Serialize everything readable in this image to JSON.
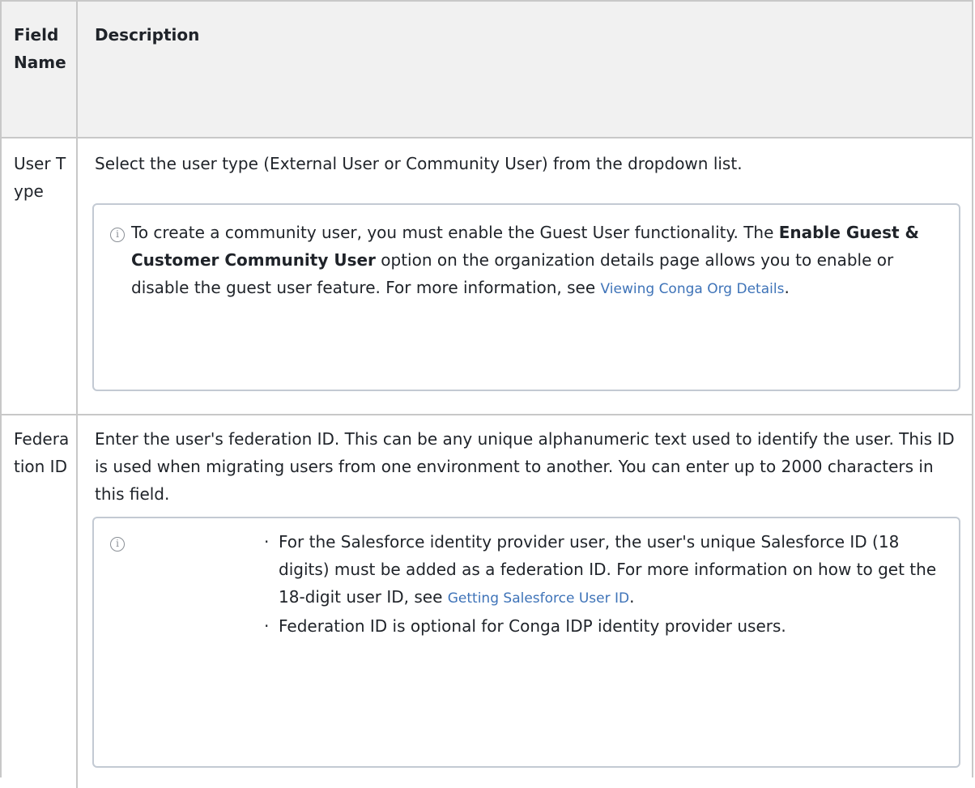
{
  "header": {
    "field_name": "Field Name",
    "description": "Description"
  },
  "rows": [
    {
      "field": "User Type",
      "description": "Select the user type (External User or Community User) from the dropdown list.",
      "note": {
        "icon": "info-icon",
        "text_before": "To create a community user, you must enable the Guest User functionality. The ",
        "bold": "Enable Guest & Customer Community User",
        "text_after": " option on the organization details page allows you to enable or disable the guest user feature. For more information, see ",
        "link": "Viewing Conga Org Details",
        "end": "."
      }
    },
    {
      "field": "Federation ID",
      "description": "Enter the user's federation ID. This can be any unique alphanumeric text used to identify the user. This ID is used when migrating users from one environment to another. You can enter up to 2000 characters in this field.",
      "note": {
        "icon": "info-icon",
        "bullets": [
          {
            "text": "For the Salesforce identity provider user, the user's unique Salesforce ID (18 digits) must be added as a federation ID. For more information on how to get the 18-digit user ID, see ",
            "link": "Getting Salesforce User ID",
            "end": "."
          },
          {
            "text": "Federation ID is optional for Conga IDP identity provider users."
          }
        ]
      }
    }
  ],
  "colors": {
    "border": "#c8c8c8",
    "header_bg": "#f1f1f1",
    "link": "#3e73b8",
    "note_border": "#c3cad3"
  }
}
